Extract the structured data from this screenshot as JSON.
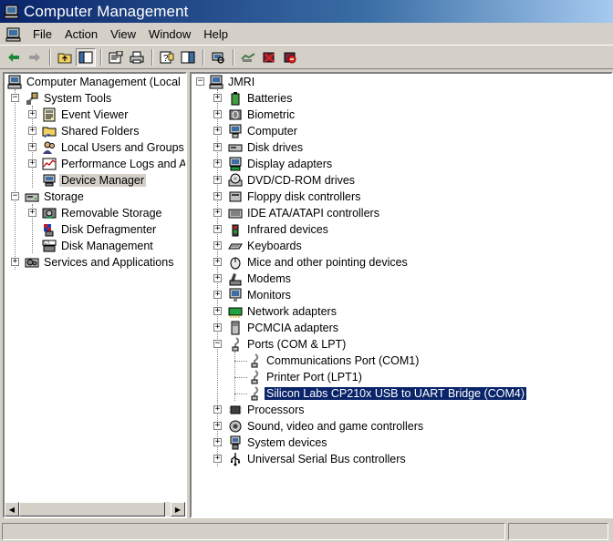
{
  "window": {
    "title": "Computer Management",
    "icon": "computer-management-icon"
  },
  "menu": {
    "items": [
      "File",
      "Action",
      "View",
      "Window",
      "Help"
    ]
  },
  "toolbar": {
    "buttons": [
      "back-arrow-icon",
      "forward-arrow-icon",
      "up-folder-icon",
      "show-hide-tree-icon",
      "properties-icon",
      "print-icon",
      "help-icon",
      "show-hide-action-pane-icon",
      "scan-hardware-icon",
      "uninstall-icon",
      "disable-icon",
      "update-driver-icon"
    ]
  },
  "left_tree": {
    "root": "Computer Management (Local",
    "system_tools": "System Tools",
    "event_viewer": "Event Viewer",
    "shared_folders": "Shared Folders",
    "local_users": "Local Users and Groups",
    "performance": "Performance Logs and A",
    "device_manager": "Device Manager",
    "storage": "Storage",
    "removable_storage": "Removable Storage",
    "disk_defrag": "Disk Defragmenter",
    "disk_mgmt": "Disk Management",
    "services": "Services and Applications"
  },
  "right_tree": {
    "root": "JMRI",
    "categories": [
      "Batteries",
      "Biometric",
      "Computer",
      "Disk drives",
      "Display adapters",
      "DVD/CD-ROM drives",
      "Floppy disk controllers",
      "IDE ATA/ATAPI controllers",
      "Infrared devices",
      "Keyboards",
      "Mice and other pointing devices",
      "Modems",
      "Monitors",
      "Network adapters",
      "PCMCIA adapters",
      "Ports (COM & LPT)"
    ],
    "ports": [
      "Communications Port (COM1)",
      "Printer Port (LPT1)",
      "Silicon Labs CP210x USB to UART Bridge (COM4)"
    ],
    "categories_after": [
      "Processors",
      "Sound, video and game controllers",
      "System devices",
      "Universal Serial Bus controllers"
    ]
  },
  "colors": {
    "title_start": "#0a246a",
    "title_end": "#a6caf0",
    "selection": "#0a246a",
    "chrome": "#d4d0c8"
  }
}
